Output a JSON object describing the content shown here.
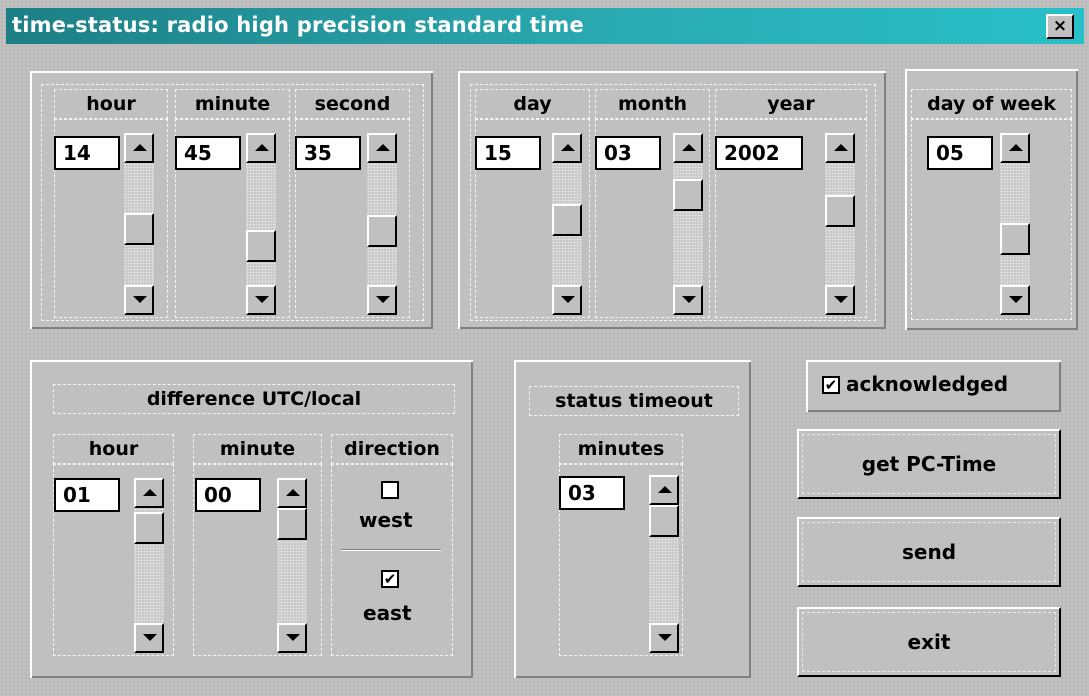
{
  "window": {
    "title": "time-status: radio high precision standard time",
    "close_glyph": "×"
  },
  "time": {
    "hour": {
      "label": "hour",
      "value": "14",
      "scroll_level": 0.55
    },
    "minute": {
      "label": "minute",
      "value": "45",
      "scroll_level": 0.74
    },
    "second": {
      "label": "second",
      "value": "35",
      "scroll_level": 0.58
    }
  },
  "date": {
    "day": {
      "label": "day",
      "value": "15",
      "scroll_level": 0.45
    },
    "month": {
      "label": "month",
      "value": "03",
      "scroll_level": 0.18
    },
    "year": {
      "label": "year",
      "value": "2002",
      "scroll_level": 0.35
    }
  },
  "weekday": {
    "label": "day of week",
    "value": "05",
    "scroll_level": 0.67
  },
  "difference": {
    "title": "difference UTC/local",
    "hour": {
      "label": "hour",
      "value": "01",
      "scroll_level": 0.05
    },
    "minute": {
      "label": "minute",
      "value": "00",
      "scroll_level": 0.0
    },
    "direction": {
      "label": "direction",
      "west_label": "west",
      "west_checked": false,
      "east_label": "east",
      "east_checked": true
    }
  },
  "status_timeout": {
    "title": "status timeout",
    "label": "minutes",
    "value": "03",
    "scroll_level": 0.0
  },
  "acknowledged": {
    "label": "acknowledged",
    "checked": true
  },
  "buttons": {
    "get_pc_time": "get PC-Time",
    "send": "send",
    "exit": "exit"
  },
  "colors": {
    "title_gradient_start": "#1d7f86",
    "title_gradient_end": "#27c0c8",
    "face": "#c0c0c0"
  }
}
